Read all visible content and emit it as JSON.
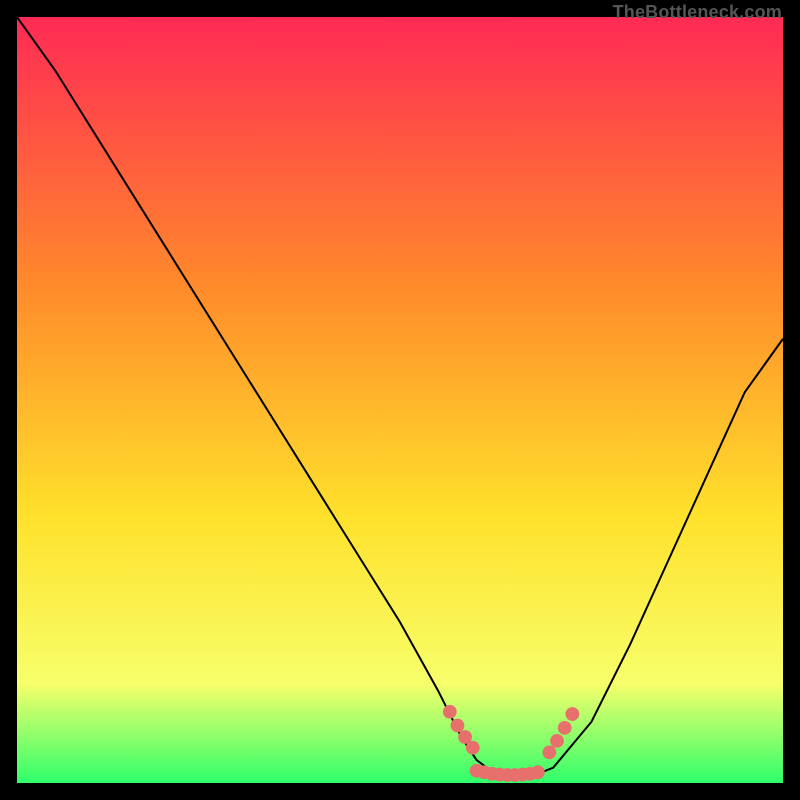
{
  "watermark": "TheBottleneck.com",
  "colors": {
    "gradient_top": "#ff2a55",
    "gradient_mid1": "#ff8a2b",
    "gradient_mid2": "#ffe12b",
    "gradient_mid3": "#f7ff6b",
    "gradient_bottom": "#2eff6b",
    "curve": "#000000",
    "marker": "#e8706c",
    "frame": "#000000"
  },
  "chart_data": {
    "type": "line",
    "title": "",
    "xlabel": "",
    "ylabel": "",
    "xlim": [
      0,
      100
    ],
    "ylim": [
      0,
      100
    ],
    "series": [
      {
        "name": "bottleneck-curve",
        "x": [
          0,
          5,
          10,
          15,
          20,
          25,
          30,
          35,
          40,
          45,
          50,
          55,
          58,
          60,
          62,
          64,
          66,
          68,
          70,
          75,
          80,
          85,
          90,
          95,
          100
        ],
        "y": [
          100,
          93,
          85,
          77,
          69,
          61,
          53,
          45,
          37,
          29,
          21,
          12,
          6,
          3,
          1.5,
          1,
          1,
          1.2,
          2,
          8,
          18,
          29,
          40,
          51,
          58
        ]
      }
    ],
    "markers": [
      {
        "name": "optimal-region-left",
        "x": [
          56.5,
          57.5,
          58.5,
          59.5
        ],
        "y": [
          9.3,
          7.5,
          6.0,
          4.6
        ]
      },
      {
        "name": "optimal-region-bottom",
        "x": [
          60,
          61,
          62,
          63,
          64,
          65,
          66,
          67,
          68
        ],
        "y": [
          1.6,
          1.4,
          1.2,
          1.1,
          1.05,
          1.05,
          1.1,
          1.2,
          1.4
        ]
      },
      {
        "name": "optimal-region-right",
        "x": [
          69.5,
          70.5,
          71.5,
          72.5
        ],
        "y": [
          4.0,
          5.5,
          7.2,
          9.0
        ]
      }
    ]
  }
}
